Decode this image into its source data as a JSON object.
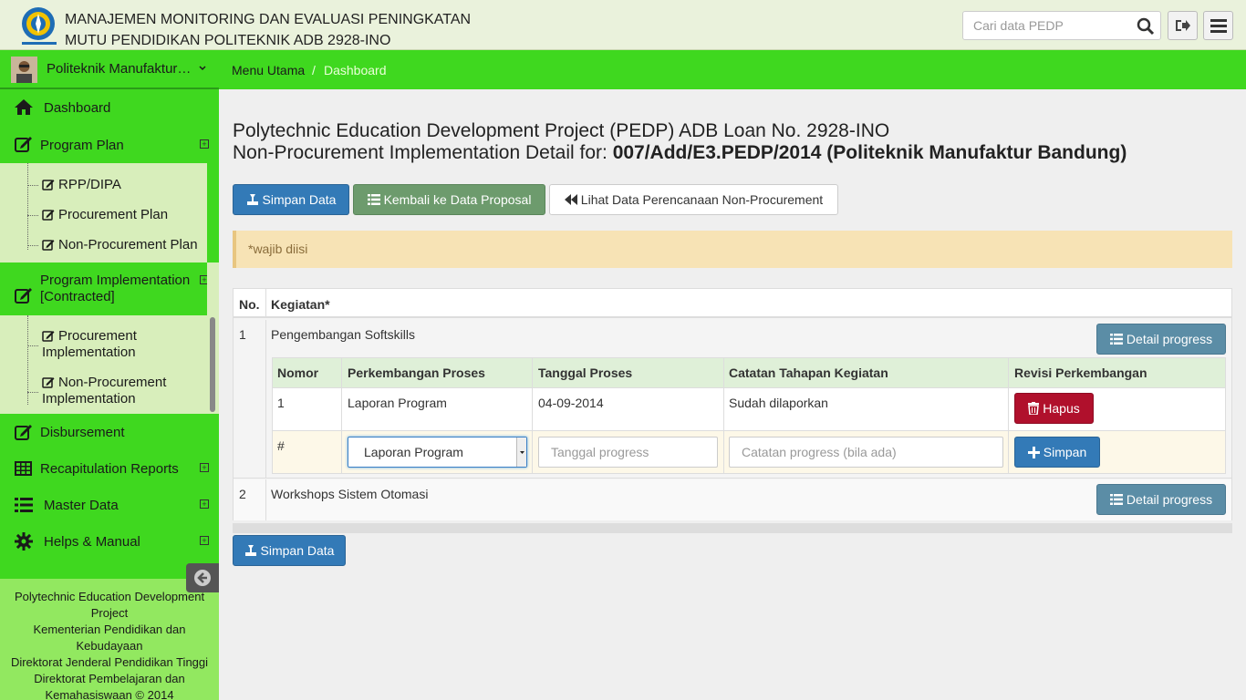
{
  "header": {
    "title_line1": "MANAJEMEN MONITORING DAN EVALUASI PENINGKATAN",
    "title_line2": "MUTU PENDIDIKAN POLITEKNIK ADB 2928-INO",
    "search_placeholder": "Cari data PEDP",
    "logo_text": "KEMENTERIAN PENDIDIKAN DAN KEBUDAYAAN"
  },
  "sidebar": {
    "unit_name": "Politeknik Manufaktur Bandung",
    "items": {
      "dashboard": "Dashboard",
      "program_plan": "Program Plan",
      "program_impl_1": "Program Implementation",
      "program_impl_2": "[Contracted]",
      "disbursement": "Disbursement",
      "recap": "Recapitulation Reports",
      "master": "Master Data",
      "helps": "Helps & Manual"
    },
    "plan_sub": [
      "RPP/DIPA",
      "Procurement Plan",
      "Non-Procurement Plan"
    ],
    "impl_sub": {
      "proc_1": "Procurement",
      "proc_2": "Implementation",
      "nonproc_1": "Non-Procurement",
      "nonproc_2": "Implementation"
    },
    "footer": {
      "line1": "Polytechnic Education Development",
      "line2": "Project",
      "line3": "Kementerian Pendidikan dan",
      "line4": "Kebudayaan",
      "line5": "Direktorat Jenderal Pendidikan Tinggi",
      "line6": "Direktorat Pembelajaran dan",
      "line7": "Kemahasiswaan © 2014"
    }
  },
  "breadcrumb": {
    "root": "Menu Utama",
    "separator": "/",
    "current": "Dashboard"
  },
  "page": {
    "title_line1": "Polytechnic Education Development Project (PEDP) ADB Loan No. 2928-INO",
    "title_line2_prefix": "Non-Procurement Implementation Detail for: ",
    "title_line2_bold": "007/Add/E3.PEDP/2014 (Politeknik Manufaktur Bandung)"
  },
  "buttons": {
    "save": "Simpan Data",
    "back": "Kembali ke Data Proposal",
    "view_plan": "Lihat Data Perencanaan Non-Procurement",
    "detail_progress": "Detail progress",
    "delete": "Hapus",
    "add_save": "Simpan",
    "save_bottom": "Simpan Data"
  },
  "alert": "*wajib diisi",
  "table": {
    "col_no": "No.",
    "col_activity": "Kegiatan*",
    "rows": [
      {
        "no": "1",
        "activity": "Pengembangan Softskills"
      },
      {
        "no": "2",
        "activity": "Workshops Sistem Otomasi"
      }
    ],
    "inner_headers": [
      "Nomor",
      "Perkembangan Proses",
      "Tanggal Proses",
      "Catatan Tahapan Kegiatan",
      "Revisi Perkembangan"
    ],
    "inner_row": {
      "nomor": "1",
      "proses": "Laporan Program",
      "tanggal": "04-09-2014",
      "catatan": "Sudah dilaporkan"
    },
    "new_row": {
      "marker": "#",
      "select_value": "Laporan Program",
      "date_placeholder": "Tanggal progress",
      "note_placeholder": "Catatan progress (bila ada)"
    }
  },
  "colors": {
    "green": "#3fd81f",
    "primary": "#337ab7",
    "danger": "#b0102c",
    "info": "#5b8da6",
    "success": "#6d9b6d"
  }
}
